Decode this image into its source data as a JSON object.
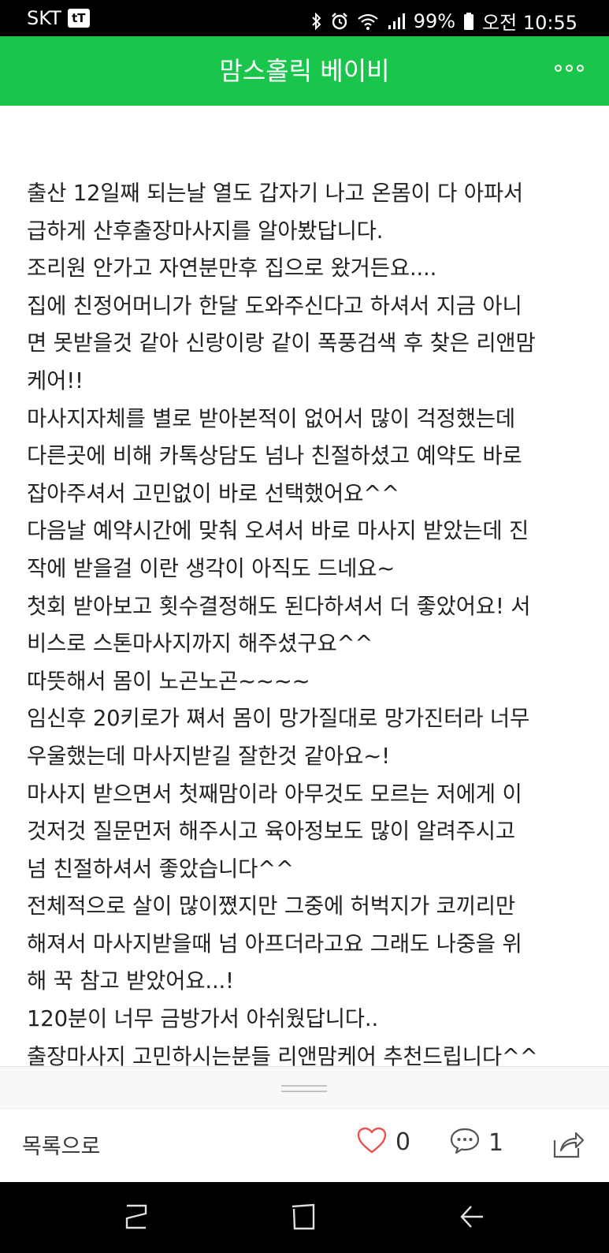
{
  "status_bar": {
    "carrier": "SKT",
    "carrier_badge": "tT",
    "battery": "99%",
    "time": "오전 10:55"
  },
  "header": {
    "title": "맘스홀릭 베이비"
  },
  "post": {
    "lines": [
      "출산 12일째 되는날 열도 갑자기 나고 온몸이 다 아파서",
      "급하게 산후출장마사지를 알아봤답니다.",
      "조리원 안가고 자연분만후 집으로 왔거든요....",
      "집에 친정어머니가 한달 도와주신다고 하셔서 지금 아니",
      "면 못받을것 같아 신랑이랑 같이 폭풍검색 후 찾은 리앤맘",
      "케어!!",
      "마사지자체를 별로 받아본적이 없어서 많이 걱정했는데",
      "다른곳에 비해 카톡상담도 넘나 친절하셨고 예약도 바로",
      "잡아주셔서 고민없이 바로 선택했어요^^",
      "다음날 예약시간에 맞춰 오셔서 바로 마사지 받았는데 진",
      "작에 받을걸 이란 생각이 아직도 드네요~",
      "첫회 받아보고 횟수결정해도 된다하셔서 더 좋았어요! 서",
      "비스로 스톤마사지까지 해주셨구요^^",
      "따뜻해서 몸이 노곤노곤~~~~",
      "임신후 20키로가 쪄서 몸이 망가질대로 망가진터라 너무",
      "우울했는데 마사지받길 잘한것 같아요~!",
      "마사지 받으면서 첫째맘이라 아무것도 모르는 저에게 이",
      "것저것 질문먼저 해주시고 육아정보도 많이 알려주시고",
      "넘 친절하셔서 좋았습니다^^",
      "전체적으로 살이 많이쪘지만 그중에 허벅지가 코끼리만",
      "해져서 마사지받을때 넘 아프더라고요 그래도 나중을 위",
      "해 꾹 참고 받았어요...!",
      "120분이 너무 금방가서 아쉬웠답니다..",
      "출장마사지 고민하시는분들 리앤맘케어 추천드립니다^^"
    ]
  },
  "footer": {
    "back_label": "목록으로",
    "like_count": "0",
    "comment_count": "1"
  },
  "icons": {
    "like": "heart-outline-icon",
    "comment": "speech-bubble-icon",
    "share": "share-arrow-icon",
    "more": "more-dots-icon"
  },
  "colors": {
    "header_bg": "#19c64b",
    "heart": "#e8524f"
  }
}
